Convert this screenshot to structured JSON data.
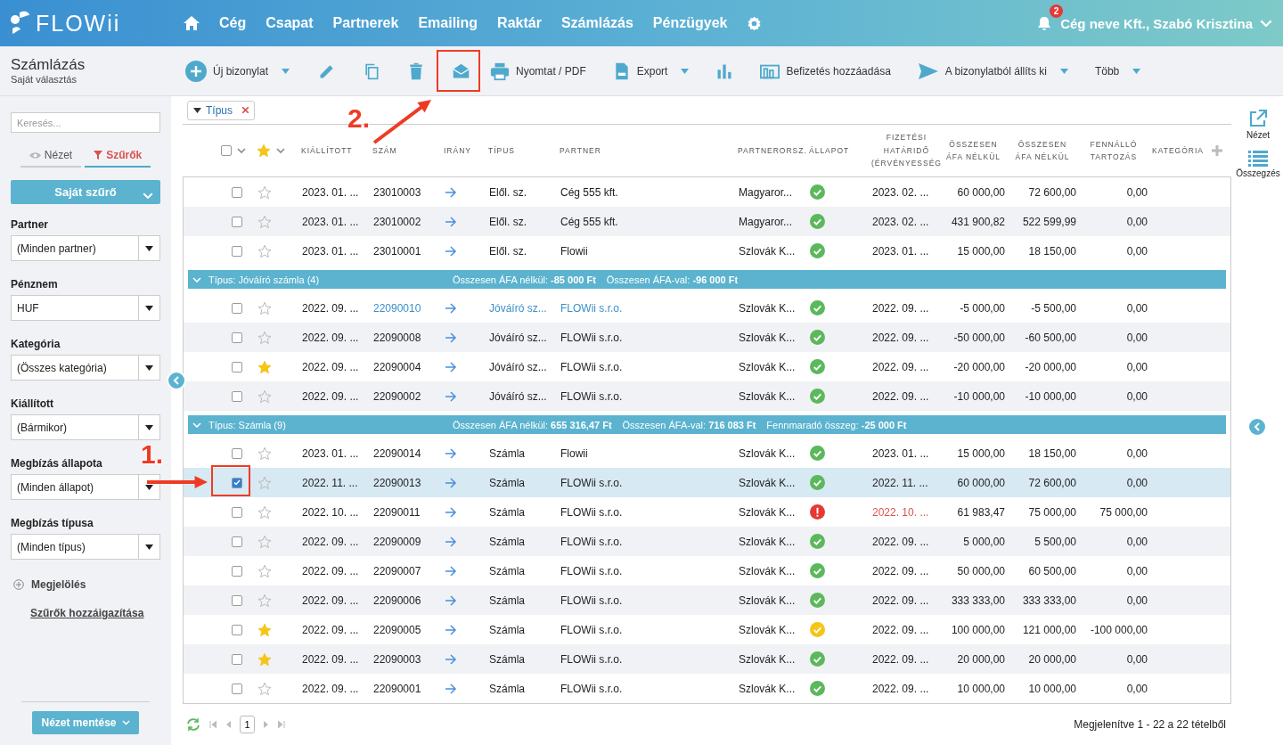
{
  "topbar": {
    "logo": "FLOWii",
    "nav": [
      {
        "label": "Cég"
      },
      {
        "label": "Csapat"
      },
      {
        "label": "Partnerek"
      },
      {
        "label": "Emailing"
      },
      {
        "label": "Raktár"
      },
      {
        "label": "Számlázás"
      },
      {
        "label": "Pénzügyek"
      }
    ],
    "notification_count": "2",
    "user": "Cég neve Kft., Szabó Krisztina"
  },
  "page": {
    "title": "Számlázás",
    "subtitle": "Saját választás"
  },
  "toolbar": [
    {
      "label": "Új bizonylat",
      "dropdown": true
    },
    {
      "dropdown": false
    },
    {
      "dropdown": false
    },
    {
      "dropdown": false
    },
    {
      "dropdown": false
    },
    {
      "label": "Nyomtat / PDF",
      "dropdown": false
    },
    {
      "label": "Export",
      "dropdown": true
    },
    {
      "dropdown": false
    },
    {
      "label": "Befizetés hozzáadása",
      "dropdown": false
    },
    {
      "label": "A bizonylatból állíts ki",
      "dropdown": true
    },
    {
      "label": "Több",
      "dropdown": true
    }
  ],
  "sidebar": {
    "search": {
      "placeholder": "Keresés..."
    },
    "tabs": [
      {
        "label": "Nézet",
        "selected": false
      },
      {
        "label": "Szűrők",
        "selected": true
      }
    ],
    "filter_button": "Saját szűrő",
    "filters": [
      {
        "label": "Partner",
        "value": "(Minden partner)"
      },
      {
        "label": "Pénznem",
        "value": "HUF"
      },
      {
        "label": "Kategória",
        "value": "(Összes kategória)"
      },
      {
        "label": "Kiállított",
        "value": "(Bármikor)"
      },
      {
        "label": "Megbízás állapota",
        "value": "(Minden állapot)"
      },
      {
        "label": "Megbízás típusa",
        "value": "(Minden típus)"
      }
    ],
    "mark": "Megjelölés",
    "adjust_link": "Szűrők hozzáigazítása",
    "save_button": "Nézet mentése"
  },
  "group_chip": "Típus",
  "select_all": {
    "checked": false
  },
  "columns": [
    "KIÁLLÍTOTT",
    "SZÁM",
    "IRÁNY",
    "TÍPUS",
    "PARTNER",
    "PARTNERORSZ.",
    "ÁLLAPOT",
    "FIZETÉSI HATÁRIDŐ (ÉRVÉNYESSÉG",
    "ÖSSZESEN ÁFA NÉLKÜL",
    "ÖSSZESEN ÁFA NÉLKÜL",
    "FENNÁLLÓ TARTOZÁS",
    "KATEGÓRIA"
  ],
  "groups": [
    {
      "rows": [
        {
          "checked": false,
          "starred": false,
          "selected": false,
          "link": false,
          "issued": "2023. 01. ...",
          "number": "23010003",
          "type": "Elől. sz.",
          "partner": "Cég 555 kft.",
          "country": "Magyaror...",
          "kind": "ok",
          "due": "2023. 02. ...",
          "overdue": false,
          "net": "60 000,00",
          "gross": "72 600,00",
          "outstanding": "0,00"
        },
        {
          "checked": false,
          "starred": false,
          "selected": false,
          "link": false,
          "issued": "2023. 01. ...",
          "number": "23010002",
          "type": "Elől. sz.",
          "partner": "Cég 555 kft.",
          "country": "Magyaror...",
          "kind": "ok",
          "due": "2023. 02. ...",
          "overdue": false,
          "net": "431 900,82",
          "gross": "522 599,99",
          "outstanding": "0,00"
        },
        {
          "checked": false,
          "starred": false,
          "selected": false,
          "link": false,
          "issued": "2023. 01. ...",
          "number": "23010001",
          "type": "Elől. sz.",
          "partner": "Flowii",
          "country": "Szlovák K...",
          "kind": "ok",
          "due": "2023. 01. ...",
          "overdue": false,
          "net": "15 000,00",
          "gross": "18 150,00",
          "outstanding": "0,00"
        }
      ]
    },
    {
      "label": "Típus: Jóváíró számla (4)",
      "summaries": [
        "Összesen ÁFA nélkül: **-85 000 Ft**",
        "Összesen ÁFA-val: **-96 000 Ft**"
      ],
      "rows": [
        {
          "checked": false,
          "starred": false,
          "selected": false,
          "link": true,
          "issued": "2022. 09. ...",
          "number": "22090010",
          "type": "Jóváíró sz...",
          "partner": "FLOWii s.r.o.",
          "country": "Szlovák K...",
          "kind": "ok",
          "due": "2022. 09. ...",
          "overdue": false,
          "net": "-5 000,00",
          "gross": "-5 500,00",
          "outstanding": "0,00"
        },
        {
          "checked": false,
          "starred": false,
          "selected": false,
          "link": false,
          "issued": "2022. 09. ...",
          "number": "22090008",
          "type": "Jóváíró sz...",
          "partner": "FLOWii s.r.o.",
          "country": "Szlovák K...",
          "kind": "ok",
          "due": "2022. 09. ...",
          "overdue": false,
          "net": "-50 000,00",
          "gross": "-60 500,00",
          "outstanding": "0,00"
        },
        {
          "checked": false,
          "starred": true,
          "selected": false,
          "link": false,
          "issued": "2022. 09. ...",
          "number": "22090004",
          "type": "Jóváíró sz...",
          "partner": "FLOWii s.r.o.",
          "country": "Szlovák K...",
          "kind": "ok",
          "due": "2022. 09. ...",
          "overdue": false,
          "net": "-20 000,00",
          "gross": "-20 000,00",
          "outstanding": "0,00"
        },
        {
          "checked": false,
          "starred": false,
          "selected": false,
          "link": false,
          "issued": "2022. 09. ...",
          "number": "22090002",
          "type": "Jóváíró sz...",
          "partner": "FLOWii s.r.o.",
          "country": "Szlovák K...",
          "kind": "ok",
          "due": "2022. 09. ...",
          "overdue": false,
          "net": "-10 000,00",
          "gross": "-10 000,00",
          "outstanding": "0,00"
        }
      ]
    },
    {
      "label": "Típus: Számla (9)",
      "summaries": [
        "Összesen ÁFA nélkül: **655 316,47 Ft**",
        "Összesen ÁFA-val: **716 083 Ft**",
        "Fennmaradó összeg: **-25 000 Ft**"
      ],
      "rows": [
        {
          "checked": false,
          "starred": false,
          "selected": false,
          "link": false,
          "issued": "2023. 01. ...",
          "number": "22090014",
          "type": "Számla",
          "partner": "Flowii",
          "country": "Szlovák K...",
          "kind": "ok",
          "due": "2023. 01. ...",
          "overdue": false,
          "net": "15 000,00",
          "gross": "18 150,00",
          "outstanding": "0,00"
        },
        {
          "checked": true,
          "starred": false,
          "selected": true,
          "link": false,
          "issued": "2022. 11. ...",
          "number": "22090013",
          "type": "Számla",
          "partner": "FLOWii s.r.o.",
          "country": "Szlovák K...",
          "kind": "ok",
          "due": "2022. 11. ...",
          "overdue": false,
          "net": "60 000,00",
          "gross": "72 600,00",
          "outstanding": "0,00"
        },
        {
          "checked": false,
          "starred": false,
          "selected": false,
          "link": false,
          "issued": "2022. 10. ...",
          "number": "22090011",
          "type": "Számla",
          "partner": "FLOWii s.r.o.",
          "country": "Szlovák K...",
          "kind": "error",
          "due": "2022. 10. ...",
          "overdue": true,
          "net": "61 983,47",
          "gross": "75 000,00",
          "outstanding": "75 000,00"
        },
        {
          "checked": false,
          "starred": false,
          "selected": false,
          "link": false,
          "issued": "2022. 09. ...",
          "number": "22090009",
          "type": "Számla",
          "partner": "FLOWii s.r.o.",
          "country": "Szlovák K...",
          "kind": "ok",
          "due": "2022. 09. ...",
          "overdue": false,
          "net": "5 000,00",
          "gross": "5 500,00",
          "outstanding": "0,00"
        },
        {
          "checked": false,
          "starred": false,
          "selected": false,
          "link": false,
          "issued": "2022. 09. ...",
          "number": "22090007",
          "type": "Számla",
          "partner": "FLOWii s.r.o.",
          "country": "Szlovák K...",
          "kind": "ok",
          "due": "2022. 09. ...",
          "overdue": false,
          "net": "50 000,00",
          "gross": "60 500,00",
          "outstanding": "0,00"
        },
        {
          "checked": false,
          "starred": false,
          "selected": false,
          "link": false,
          "issued": "2022. 09. ...",
          "number": "22090006",
          "type": "Számla",
          "partner": "FLOWii s.r.o.",
          "country": "Szlovák K...",
          "kind": "ok",
          "due": "2022. 09. ...",
          "overdue": false,
          "net": "333 333,00",
          "gross": "333 333,00",
          "outstanding": "0,00"
        },
        {
          "checked": false,
          "starred": true,
          "selected": false,
          "link": false,
          "issued": "2022. 09. ...",
          "number": "22090005",
          "type": "Számla",
          "partner": "FLOWii s.r.o.",
          "country": "Szlovák K...",
          "kind": "warning",
          "due": "2022. 09. ...",
          "overdue": false,
          "net": "100 000,00",
          "gross": "121 000,00",
          "outstanding": "-100 000,00"
        },
        {
          "checked": false,
          "starred": true,
          "selected": false,
          "link": false,
          "issued": "2022. 09. ...",
          "number": "22090003",
          "type": "Számla",
          "partner": "FLOWii s.r.o.",
          "country": "Szlovák K...",
          "kind": "ok",
          "due": "2022. 09. ...",
          "overdue": false,
          "net": "20 000,00",
          "gross": "20 000,00",
          "outstanding": "0,00"
        },
        {
          "checked": false,
          "starred": false,
          "selected": false,
          "link": false,
          "issued": "2022. 09. ...",
          "number": "22090001",
          "type": "Számla",
          "partner": "FLOWii s.r.o.",
          "country": "Szlovák K...",
          "kind": "ok",
          "due": "2022. 09. ...",
          "overdue": false,
          "net": "10 000,00",
          "gross": "10 000,00",
          "outstanding": "0,00"
        }
      ]
    }
  ],
  "pager": {
    "page": "1",
    "summary": "Megjelenítve 1 - 22 a 22 tételből"
  },
  "right_panel": [
    {
      "label": "Nézet"
    },
    {
      "label": "Összegzés"
    }
  ],
  "annotations": [
    {
      "label": "1."
    },
    {
      "label": "2."
    }
  ]
}
